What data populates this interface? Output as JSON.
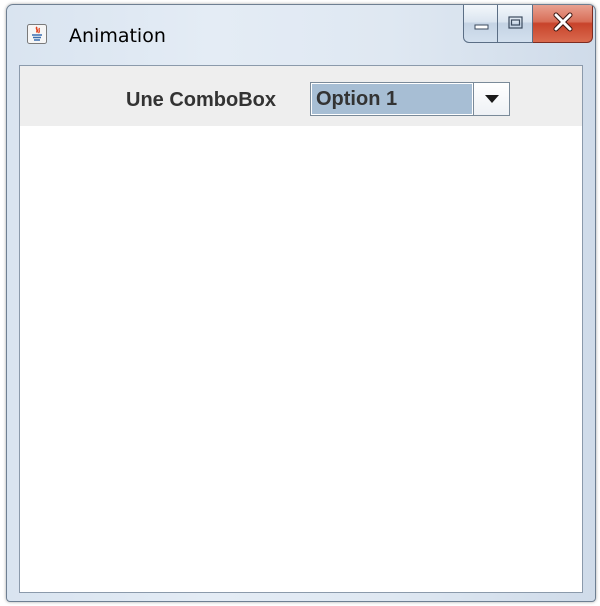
{
  "window": {
    "title": "Animation"
  },
  "icons": {
    "app": "java-app-icon",
    "minimize": "minimize-icon",
    "maximize": "maximize-icon",
    "close": "close-icon",
    "dropdown": "chevron-down-icon"
  },
  "toolbar": {
    "combo_label": "Une ComboBox",
    "combo": {
      "selected": "Option 1"
    }
  },
  "colors": {
    "combo_selection_bg": "#a7bed4",
    "panel_bg": "#eeeeee",
    "close_button": "#c8432b"
  }
}
